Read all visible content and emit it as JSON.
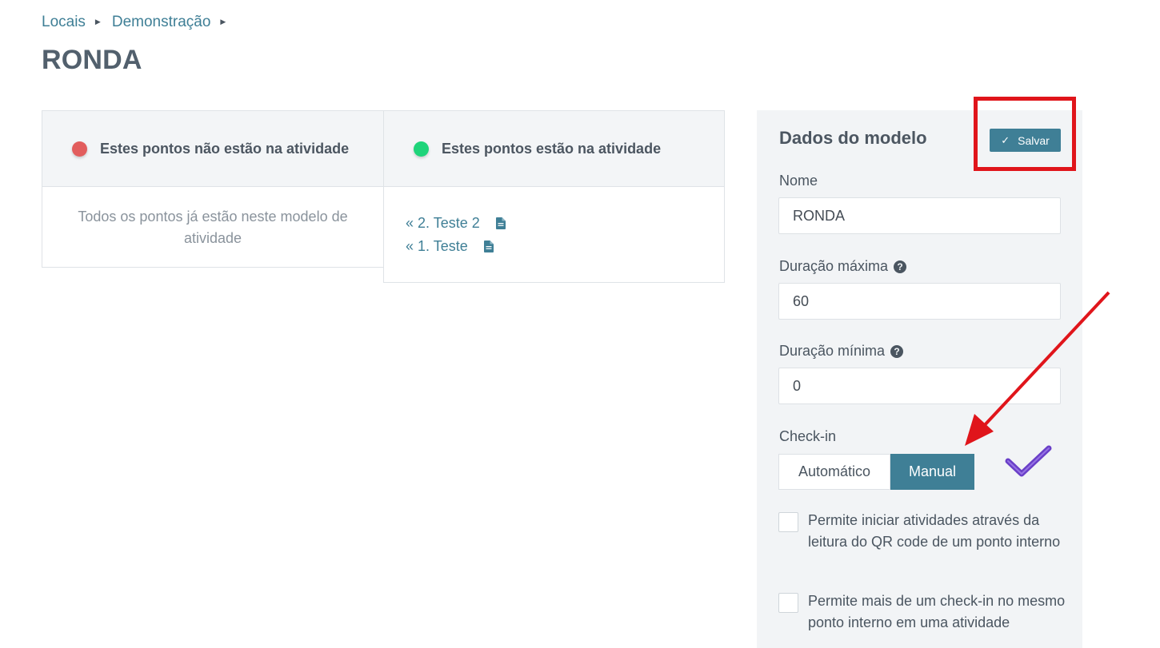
{
  "breadcrumb": {
    "items": [
      "Locais",
      "Demonstração"
    ]
  },
  "page": {
    "title": "RONDA"
  },
  "panels": {
    "out": {
      "title": "Estes pontos não estão na atividade",
      "dot_color": "#e25d5d",
      "empty_message": "Todos os pontos já estão neste modelo de atividade"
    },
    "in": {
      "title": "Estes pontos estão na atividade",
      "dot_color": "#1ed47a",
      "items": [
        {
          "label": "« 2. Teste 2",
          "icon": "document-icon"
        },
        {
          "label": "« 1. Teste",
          "icon": "document-icon"
        }
      ]
    }
  },
  "form": {
    "heading": "Dados do modelo",
    "save_label": "Salvar",
    "name_label": "Nome",
    "name_value": "RONDA",
    "max_label": "Duração máxima",
    "max_value": "60",
    "min_label": "Duração mínima",
    "min_value": "0",
    "checkin_label": "Check-in",
    "checkin_options": [
      "Automático",
      "Manual"
    ],
    "checkin_selected": "Manual",
    "checkbox1": "Permite iniciar atividades através da leitura do QR code de um ponto interno",
    "checkbox2": "Permite mais de um check-in no mesmo ponto interno em uma atividade"
  },
  "colors": {
    "accent": "#3f7f96",
    "annotation_red": "#e0151b",
    "annotation_check": "#6a3fc8"
  }
}
